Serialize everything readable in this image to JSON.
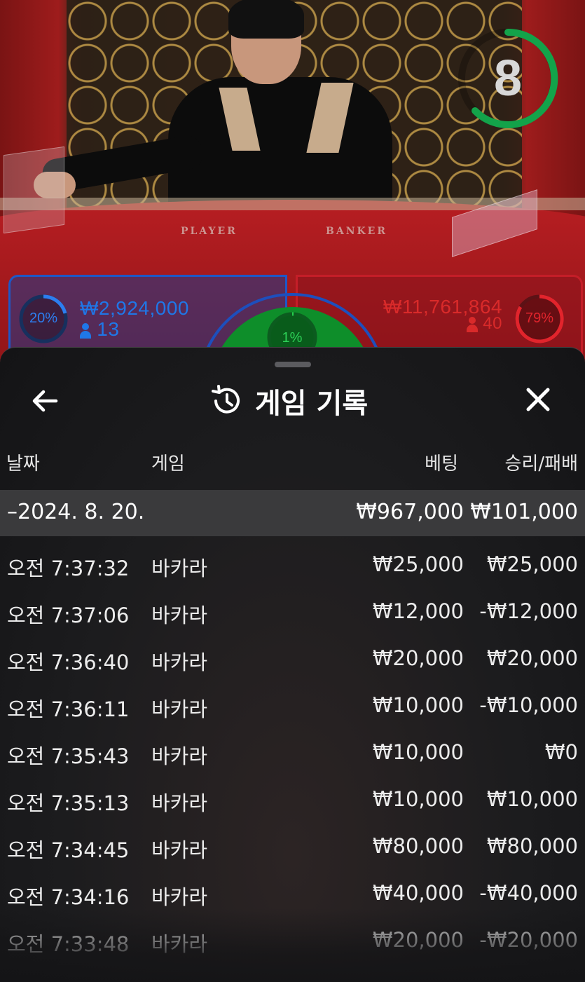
{
  "video": {
    "timer": "8",
    "table_labels": {
      "player": "PLAYER",
      "banker": "BANKER"
    },
    "player_bet": {
      "percent": "20%",
      "amount": "₩2,924,000",
      "players": "13",
      "color": "#1d6fe0"
    },
    "tie_bet": {
      "percent": "1%",
      "color": "#13a13a"
    },
    "banker_bet": {
      "percent": "79%",
      "amount": "₩11,761,864",
      "players": "40",
      "color": "#d92a2a"
    }
  },
  "sheet": {
    "title": "게임 기록",
    "title_icon": "history-icon",
    "back_icon": "arrow-left-icon",
    "close_icon": "close-icon",
    "columns": {
      "date": "날짜",
      "game": "게임",
      "bet": "베팅",
      "result": "승리/패배"
    },
    "date_group": {
      "label": "–2024. 8. 20.",
      "bet": "₩967,000",
      "result": "₩101,000"
    },
    "rows": [
      {
        "time": "오전 7:37:32",
        "game": "바카라",
        "bet": "₩25,000",
        "result": "₩25,000"
      },
      {
        "time": "오전 7:37:06",
        "game": "바카라",
        "bet": "₩12,000",
        "result": "-₩12,000"
      },
      {
        "time": "오전 7:36:40",
        "game": "바카라",
        "bet": "₩20,000",
        "result": "₩20,000"
      },
      {
        "time": "오전 7:36:11",
        "game": "바카라",
        "bet": "₩10,000",
        "result": "-₩10,000"
      },
      {
        "time": "오전 7:35:43",
        "game": "바카라",
        "bet": "₩10,000",
        "result": "₩0"
      },
      {
        "time": "오전 7:35:13",
        "game": "바카라",
        "bet": "₩10,000",
        "result": "₩10,000"
      },
      {
        "time": "오전 7:34:45",
        "game": "바카라",
        "bet": "₩80,000",
        "result": "₩80,000"
      },
      {
        "time": "오전 7:34:16",
        "game": "바카라",
        "bet": "₩40,000",
        "result": "-₩40,000"
      },
      {
        "time": "오전 7:33:48",
        "game": "바카라",
        "bet": "₩20,000",
        "result": "-₩20,000"
      }
    ]
  }
}
